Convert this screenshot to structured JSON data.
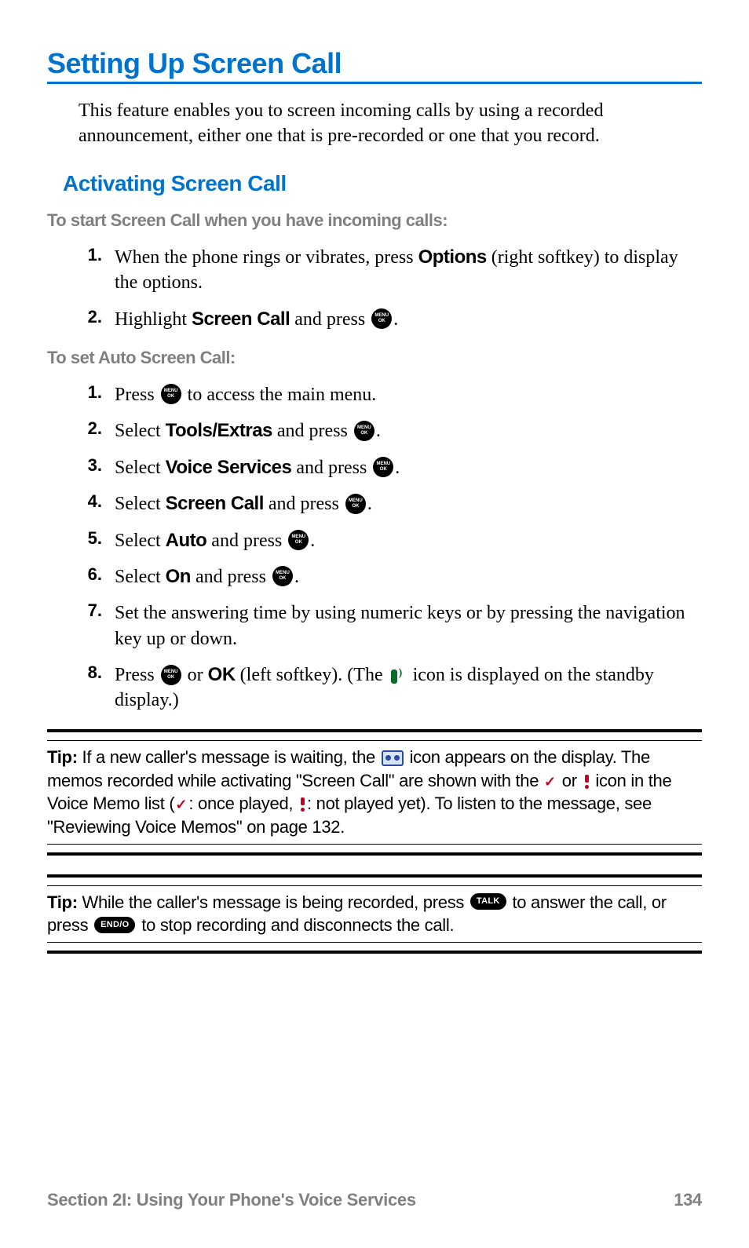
{
  "h1": "Setting Up Screen Call",
  "intro": "This feature enables you to screen incoming calls by using a recorded announcement, either one that is pre-recorded or one that you record.",
  "h2": "Activating Screen Call",
  "prompt1": "To start Screen Call when you have incoming calls:",
  "listA": {
    "s1": {
      "num": "1.",
      "a": "When the phone rings or vibrates, press ",
      "b": "Options",
      "c": " (right softkey) to display the options."
    },
    "s2": {
      "num": "2.",
      "a": "Highlight ",
      "b": "Screen Call",
      "c": " and press ",
      "d": "."
    }
  },
  "prompt2": "To set Auto Screen Call:",
  "listB": {
    "s1": {
      "num": "1.",
      "a": "Press ",
      "b": " to access the main menu."
    },
    "s2": {
      "num": "2.",
      "a": "Select ",
      "b": "Tools/Extras",
      "c": " and press ",
      "d": "."
    },
    "s3": {
      "num": "3.",
      "a": "Select ",
      "b": "Voice Services",
      "c": " and press ",
      "d": "."
    },
    "s4": {
      "num": "4.",
      "a": "Select ",
      "b": "Screen Call",
      "c": " and press ",
      "d": "."
    },
    "s5": {
      "num": "5.",
      "a": "Select ",
      "b": "Auto",
      "c": " and press ",
      "d": "."
    },
    "s6": {
      "num": "6.",
      "a": "Select ",
      "b": "On",
      "c": " and press ",
      "d": "."
    },
    "s7": {
      "num": "7.",
      "a": "Set the answering time by using numeric keys or by pressing the navigation key up or down."
    },
    "s8": {
      "num": "8.",
      "a": "Press ",
      "b": " or ",
      "c": "OK",
      "d": " (left softkey). (The ",
      "e": " icon is displayed on the standby display.)"
    }
  },
  "tip1": {
    "label": "Tip:",
    "a": " If a new caller's message is waiting, the ",
    "b": " icon appears on the display. The memos recorded while activating \"Screen Call\" are shown with the ",
    "c": " or ",
    "d": " icon in the Voice Memo list (",
    "e": ": once played, ",
    "f": ": not played yet). To listen to the message, see \"Reviewing Voice Memos\" on page 132."
  },
  "tip2": {
    "label": "Tip:",
    "a": " While the caller's message is being recorded, press ",
    "talk": "TALK",
    "b": " to answer the call, or press ",
    "end": "END/O",
    "c": " to stop recording and disconnects the call."
  },
  "footer": {
    "section": "Section 2I: Using Your Phone's Voice Services",
    "page": "134"
  }
}
